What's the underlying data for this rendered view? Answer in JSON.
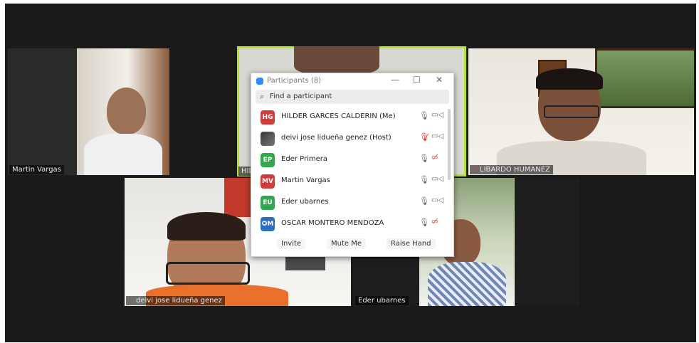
{
  "tiles": {
    "martin": {
      "name": "Martin Vargas"
    },
    "center": {
      "name": "HIL"
    },
    "libardo": {
      "name": "LIBARDO HUMANEZ"
    },
    "deivi": {
      "name": "deivi jose lidueña genez"
    },
    "eder": {
      "name": "Eder ubarnes"
    }
  },
  "panel": {
    "title": "Participants (8)",
    "minimize": "—",
    "maximize": "☐",
    "close": "✕",
    "search_placeholder": "Find a participant",
    "participants": [
      {
        "initials": "HG",
        "name": "HILDER GARCES CALDERIN (Me)",
        "color": "#d13b3b",
        "mic": "unmuted",
        "video": "on"
      },
      {
        "initials": "",
        "name": "deivi jose lidueña genez (Host)",
        "color": "#444444",
        "mic": "muted",
        "video": "on"
      },
      {
        "initials": "EP",
        "name": "Eder Primera",
        "color": "#2fa84f",
        "mic": "unmuted",
        "video": "off"
      },
      {
        "initials": "MV",
        "name": "Martin Vargas",
        "color": "#d13b3b",
        "mic": "unmuted",
        "video": "on"
      },
      {
        "initials": "EU",
        "name": "Eder ubarnes",
        "color": "#2fa84f",
        "mic": "unmuted",
        "video": "on"
      },
      {
        "initials": "OM",
        "name": "OSCAR MONTERO MENDOZA",
        "color": "#2d6fbf",
        "mic": "unmuted",
        "video": "off"
      }
    ],
    "buttons": {
      "invite": "Invite",
      "mute_me": "Mute Me",
      "raise_hand": "Raise Hand"
    }
  },
  "colors": {
    "active_speaker": "#b5e32d",
    "muted": "#e0312b",
    "zoom_blue": "#2d8cff"
  }
}
